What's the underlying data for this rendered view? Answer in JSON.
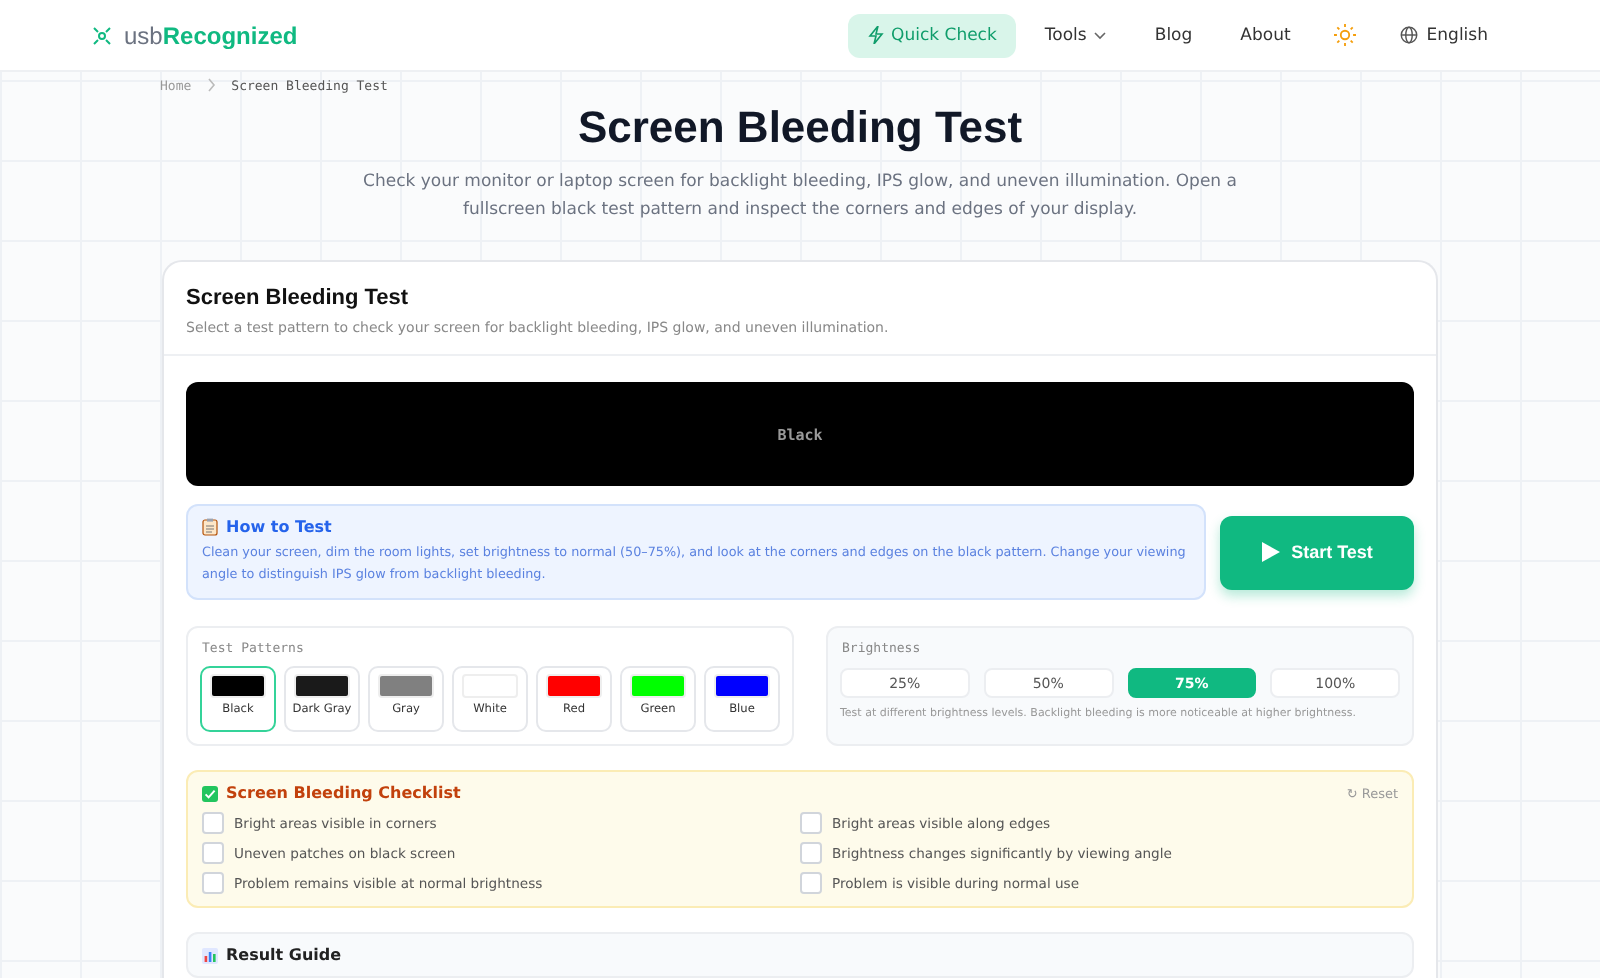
{
  "nav": {
    "logo_prefix": "usb",
    "logo_brand": "Recognized",
    "items": [
      {
        "label": "Quick Check",
        "kind": "primary"
      },
      {
        "label": "Tools",
        "kind": "dropdown"
      },
      {
        "label": "Blog",
        "kind": "link"
      },
      {
        "label": "About",
        "kind": "link"
      }
    ],
    "language": "English"
  },
  "breadcrumb": [
    "Home",
    "Screen Bleeding Test"
  ],
  "page": {
    "title": "Screen Bleeding Test",
    "description": "Check your monitor or laptop screen for backlight bleeding, IPS glow, and uneven illumination. Open a fullscreen black test pattern and inspect the corners and edges of your display."
  },
  "card": {
    "title": "Screen Bleeding Test",
    "subtitle": "Select a test pattern to check your screen for backlight bleeding, IPS glow, and uneven illumination.",
    "preview": {
      "label": "Black",
      "color": "#000000"
    },
    "how_to": {
      "title": "How to Test",
      "text": "Clean your screen, dim the room lights, set brightness to normal (50–75%), and look at the corners and edges on the black pattern. Change your viewing angle to distinguish IPS glow from backlight bleeding."
    },
    "start_button": "Start Test",
    "patterns": {
      "title": "Test Patterns",
      "items": [
        {
          "label": "Black",
          "color": "#000000",
          "selected": true
        },
        {
          "label": "Dark Gray",
          "color": "#1a1a1a",
          "selected": false
        },
        {
          "label": "Gray",
          "color": "#808080",
          "selected": false
        },
        {
          "label": "White",
          "color": "#ffffff",
          "selected": false
        },
        {
          "label": "Red",
          "color": "#ff0000",
          "selected": false
        },
        {
          "label": "Green",
          "color": "#00ff00",
          "selected": false
        },
        {
          "label": "Blue",
          "color": "#0000ff",
          "selected": false
        }
      ]
    },
    "brightness": {
      "title": "Brightness",
      "options": [
        {
          "label": "25%",
          "selected": false
        },
        {
          "label": "50%",
          "selected": false
        },
        {
          "label": "75%",
          "selected": true
        },
        {
          "label": "100%",
          "selected": false
        }
      ],
      "note": "Test at different brightness levels. Backlight bleeding is more noticeable at higher brightness."
    },
    "checklist": {
      "title": "Screen Bleeding Checklist",
      "reset": "↻ Reset",
      "items": [
        {
          "label": "Bright areas visible in corners",
          "checked": false
        },
        {
          "label": "Bright areas visible along edges",
          "checked": false
        },
        {
          "label": "Uneven patches on black screen",
          "checked": false
        },
        {
          "label": "Brightness changes significantly by viewing angle",
          "checked": false
        },
        {
          "label": "Problem remains visible at normal brightness",
          "checked": false
        },
        {
          "label": "Problem is visible during normal use",
          "checked": false
        }
      ]
    },
    "result_guide": {
      "title": "Result Guide"
    }
  }
}
